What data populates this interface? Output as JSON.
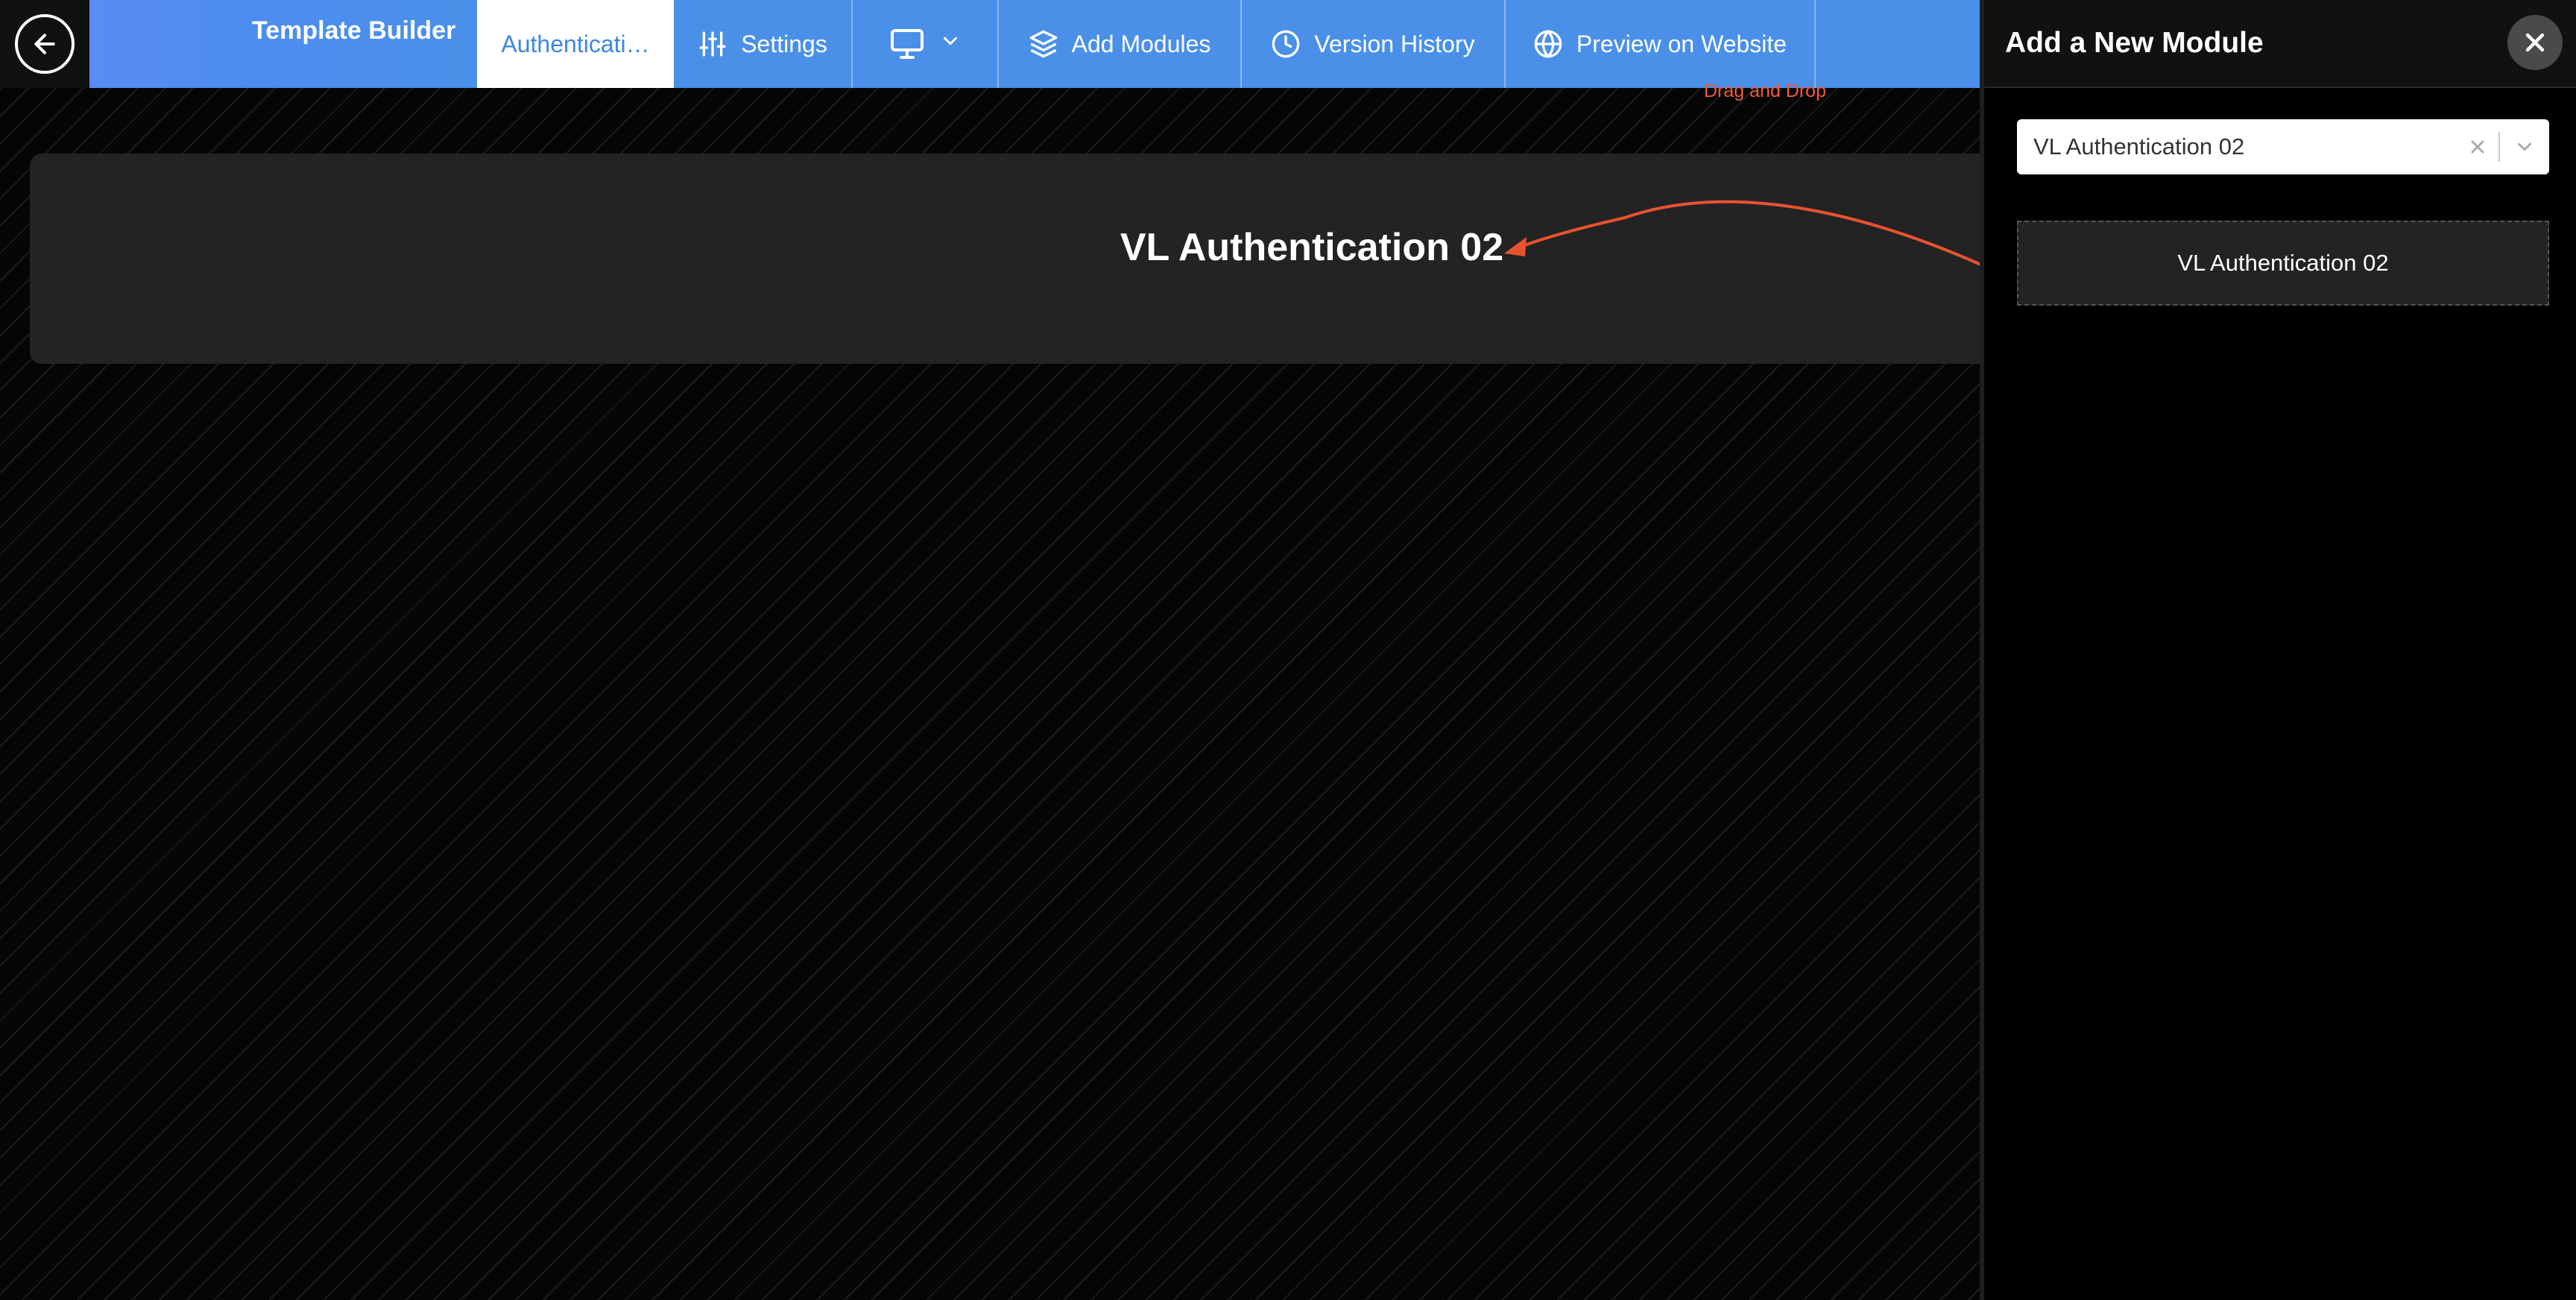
{
  "app": {
    "brand_title": "Template Builder"
  },
  "toolbar": {
    "active_tab": "Authenticati…",
    "settings": "Settings",
    "add_modules": "Add Modules",
    "version_history": "Version History",
    "preview": "Preview on Website"
  },
  "canvas": {
    "module_title": "VL Authentication 02",
    "hint": "Drag and Drop"
  },
  "panel": {
    "title": "Add a New Module",
    "select_value": "VL Authentication 02",
    "draggable_item": "VL Authentication 02"
  },
  "icons": {
    "back": "arrow-left-icon",
    "settings": "sliders-icon",
    "device": "monitor-icon",
    "device_dropdown": "chevron-down-icon",
    "add_modules": "layers-icon",
    "version_history": "clock-icon",
    "preview": "globe-icon",
    "close": "close-icon",
    "clear": "x-icon",
    "select_caret": "chevron-down-icon"
  },
  "colors": {
    "toolbar_bg": "#4a90e8",
    "accent_text": "#3d88e0",
    "hint_color": "#f05a3c",
    "card_bg": "#232323"
  }
}
